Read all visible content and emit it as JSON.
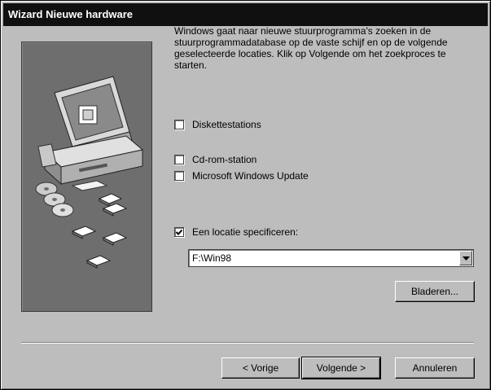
{
  "window": {
    "title": "Wizard Nieuwe hardware"
  },
  "description": "Windows gaat naar nieuwe stuurprogramma's zoeken in de stuurprogrammadatabase op de vaste schijf en op de volgende geselecteerde locaties. Klik op Volgende om het zoekproces te starten.",
  "options": [
    {
      "label": "Diskettestations",
      "checked": false
    },
    {
      "label": "Cd-rom-station",
      "checked": false
    },
    {
      "label": "Microsoft Windows Update",
      "checked": false
    },
    {
      "label": "Een locatie specificeren:",
      "checked": true
    }
  ],
  "location": {
    "value": "F:\\Win98"
  },
  "buttons": {
    "browse": "Bladeren...",
    "back": "< Vorige",
    "next": "Volgende >",
    "cancel": "Annuleren"
  }
}
